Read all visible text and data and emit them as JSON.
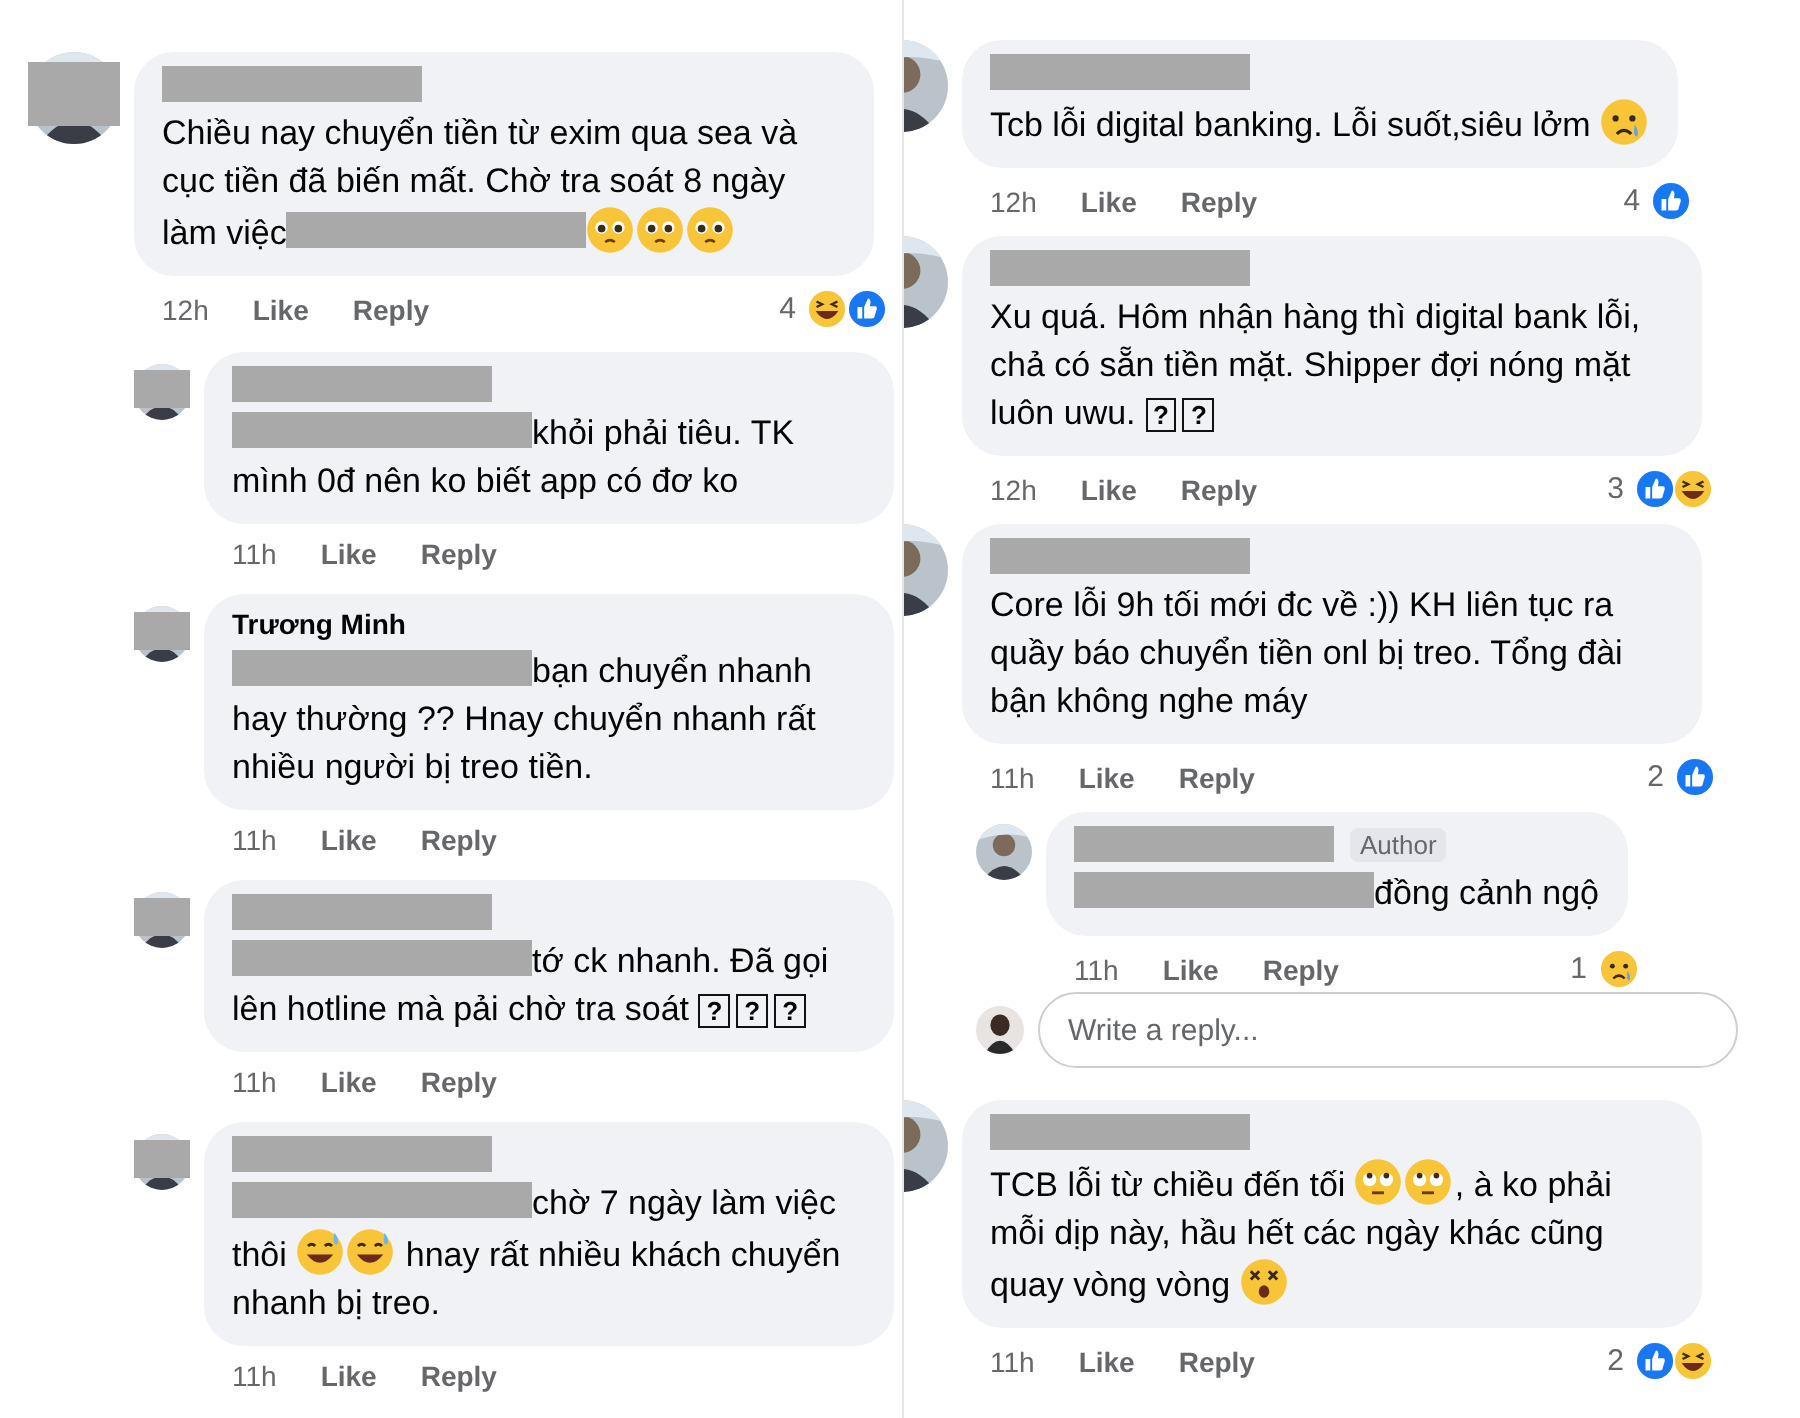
{
  "panels": [
    {
      "comments": [
        {
          "kind": "top",
          "avatar_redacted": true,
          "name": {
            "kind": "redacted"
          },
          "body": [
            {
              "kind": "text",
              "text": "Chiều nay chuyển tiền từ exim qua sea và cục tiền đã biến mất. Chờ tra soát 8 ngày làm việc"
            },
            {
              "kind": "redacted"
            },
            {
              "kind": "pleading"
            },
            {
              "kind": "pleading"
            },
            {
              "kind": "pleading"
            }
          ],
          "meta": {
            "time": "12h",
            "like": "Like",
            "reply": "Reply",
            "count": "4",
            "reactions": [
              {
                "kind": "haha"
              },
              {
                "kind": "like"
              }
            ]
          }
        },
        {
          "kind": "reply",
          "avatar_redacted": true,
          "name": {
            "kind": "redacted"
          },
          "body": [
            {
              "kind": "redacted"
            },
            {
              "kind": "text",
              "text": "khỏi phải tiêu. TK mình 0đ nên ko biết app có đơ ko"
            }
          ],
          "meta": {
            "time": "11h",
            "like": "Like",
            "reply": "Reply"
          }
        },
        {
          "kind": "reply",
          "avatar_redacted": true,
          "name": {
            "kind": "text",
            "text": "Trương Minh"
          },
          "body": [
            {
              "kind": "redacted"
            },
            {
              "kind": "text",
              "text": "bạn chuyển nhanh hay thường ?? Hnay chuyển nhanh rất nhiều người bị treo tiền."
            }
          ],
          "meta": {
            "time": "11h",
            "like": "Like",
            "reply": "Reply"
          }
        },
        {
          "kind": "reply",
          "avatar_redacted": true,
          "name": {
            "kind": "redacted"
          },
          "body": [
            {
              "kind": "redacted"
            },
            {
              "kind": "text",
              "text": "tớ ck nhanh. Đã gọi lên hotline mà pải chờ tra soát "
            },
            {
              "kind": "box",
              "text": "?"
            },
            {
              "kind": "box",
              "text": "?"
            },
            {
              "kind": "box",
              "text": "?"
            }
          ],
          "meta": {
            "time": "11h",
            "like": "Like",
            "reply": "Reply"
          }
        },
        {
          "kind": "reply",
          "avatar_redacted": true,
          "name": {
            "kind": "redacted"
          },
          "body": [
            {
              "kind": "redacted"
            },
            {
              "kind": "text",
              "text": "chờ 7 ngày làm việc thôi "
            },
            {
              "kind": "sweat"
            },
            {
              "kind": "sweat"
            },
            {
              "kind": "text",
              "text": " hnay rất nhiều khách chuyển nhanh bị treo."
            }
          ],
          "meta": {
            "time": "11h",
            "like": "Like",
            "reply": "Reply"
          }
        }
      ]
    },
    {
      "comments": [
        {
          "kind": "top",
          "avatar_redacted": false,
          "name": {
            "kind": "redacted"
          },
          "body": [
            {
              "kind": "text",
              "text": "Tcb lỗi digital banking. Lỗi suốt,siêu lởm "
            },
            {
              "kind": "tear"
            }
          ],
          "meta": {
            "time": "12h",
            "like": "Like",
            "reply": "Reply",
            "count": "4",
            "reactions": [
              {
                "kind": "like"
              }
            ]
          }
        },
        {
          "kind": "top",
          "avatar_redacted": false,
          "name": {
            "kind": "redacted"
          },
          "body": [
            {
              "kind": "text",
              "text": "Xu quá. Hôm nhận hàng thì digital bank lỗi, chả có sẵn tiền mặt. Shipper đợi nóng mặt luôn uwu. "
            },
            {
              "kind": "box",
              "text": "?"
            },
            {
              "kind": "box",
              "text": "?"
            }
          ],
          "meta": {
            "time": "12h",
            "like": "Like",
            "reply": "Reply",
            "count": "3",
            "reactions": [
              {
                "kind": "like"
              },
              {
                "kind": "haha"
              }
            ]
          }
        },
        {
          "kind": "top",
          "avatar_redacted": false,
          "name": {
            "kind": "redacted"
          },
          "body": [
            {
              "kind": "text",
              "text": "Core lỗi 9h tối mới đc về :)) KH liên tục ra quầy báo chuyển tiền onl bị treo. Tổng đài bận không nghe máy"
            }
          ],
          "meta": {
            "time": "11h",
            "like": "Like",
            "reply": "Reply",
            "count": "2",
            "reactions": [
              {
                "kind": "like"
              }
            ]
          }
        },
        {
          "kind": "reply",
          "avatar_redacted": false,
          "name": {
            "kind": "redacted"
          },
          "badge": "Author",
          "body": [
            {
              "kind": "redacted"
            },
            {
              "kind": "text",
              "text": "đồng cảnh ngộ"
            }
          ],
          "meta": {
            "time": "11h",
            "like": "Like",
            "reply": "Reply",
            "count": "1",
            "reactions": [
              {
                "kind": "tear"
              }
            ]
          }
        },
        {
          "kind": "composer",
          "placeholder": "Write a reply..."
        },
        {
          "kind": "top",
          "avatar_redacted": false,
          "name": {
            "kind": "redacted"
          },
          "body": [
            {
              "kind": "text",
              "text": "TCB lỗi từ chiều đến tối "
            },
            {
              "kind": "eyeroll"
            },
            {
              "kind": "eyeroll"
            },
            {
              "kind": "text",
              "text": ", à ko phải mỗi dịp này, hầu hết các ngày khác cũng quay vòng vòng "
            },
            {
              "kind": "dizzy"
            }
          ],
          "meta": {
            "time": "11h",
            "like": "Like",
            "reply": "Reply",
            "count": "2",
            "reactions": [
              {
                "kind": "like"
              },
              {
                "kind": "haha"
              }
            ]
          }
        }
      ]
    }
  ]
}
